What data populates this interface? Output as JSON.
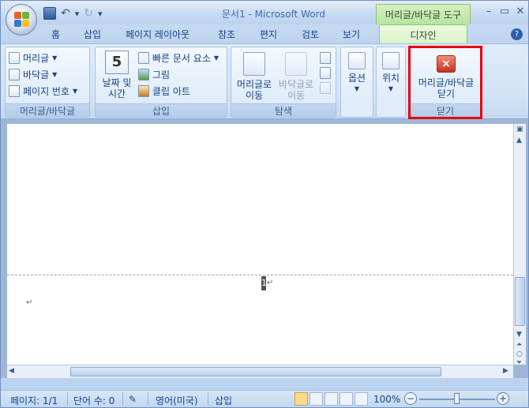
{
  "window": {
    "title": "문서1 - Microsoft Word",
    "context_tool": "머리글/바닥글 도구",
    "minimize": "–",
    "restore": "▭",
    "close": "✕"
  },
  "qat": {
    "save": "save-icon",
    "undo": "↶",
    "undo_arrow": "▾",
    "redo": "↻",
    "customize": "▾"
  },
  "tabs": [
    "홈",
    "삽입",
    "페이지 레이아웃",
    "참조",
    "편지",
    "검토",
    "보기"
  ],
  "active_tab": "디자인",
  "help": "?",
  "ribbon": {
    "header_footer": {
      "items": [
        "머리글",
        "바닥글",
        "페이지 번호"
      ],
      "label": "머리글/바닥글"
    },
    "insert": {
      "date_time_line1": "날짜 및",
      "date_time_line2": "시간",
      "date_icon_text": "5",
      "quick_parts": "빠른 문서 요소",
      "picture": "그림",
      "clipart": "클립 아트",
      "label": "삽입"
    },
    "navigation": {
      "goto_header_line1": "머리글로",
      "goto_header_line2": "이동",
      "goto_footer_line1": "바닥글로",
      "goto_footer_line2": "이동",
      "label": "탐색"
    },
    "options": {
      "label_btn": "옵션"
    },
    "position": {
      "label_btn": "위치"
    },
    "close": {
      "line1": "머리글/바닥글",
      "line2": "닫기",
      "label": "닫기"
    }
  },
  "document": {
    "page_number": "1",
    "return_mark": "↵"
  },
  "status": {
    "page": "페이지: 1/1",
    "words": "단어 수: 0",
    "language": "영어(미국)",
    "mode": "삽입",
    "zoom": "100%",
    "zoom_minus": "−",
    "zoom_plus": "+"
  }
}
